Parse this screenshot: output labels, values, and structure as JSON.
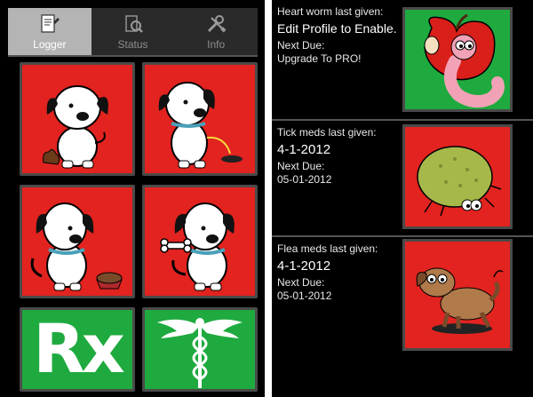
{
  "tabs": [
    {
      "label": "Logger",
      "icon": "document-pen-icon",
      "active": true
    },
    {
      "label": "Status",
      "icon": "magnifier-document-icon",
      "active": false
    },
    {
      "label": "Info",
      "icon": "wrench-screwdriver-icon",
      "active": false
    }
  ],
  "tiles": [
    {
      "name": "dog-poop-tile",
      "color": "#e2231f"
    },
    {
      "name": "dog-pee-tile",
      "color": "#e2231f"
    },
    {
      "name": "dog-food-tile",
      "color": "#e2231f"
    },
    {
      "name": "dog-treat-tile",
      "color": "#e2231f"
    },
    {
      "name": "rx-tile",
      "color": "#1faa3f",
      "text": "Rx"
    },
    {
      "name": "caduceus-tile",
      "color": "#1faa3f"
    }
  ],
  "reminders": [
    {
      "label": "Heart worm last given:",
      "value": "Edit Profile to Enable.",
      "due_label": "Next Due:",
      "due_value": "Upgrade To PRO!",
      "tile_color": "#1faa3f",
      "icon": "worm-apple-icon"
    },
    {
      "label": "Tick meds last given:",
      "value": "4-1-2012",
      "due_label": "Next Due:",
      "due_value": "05-01-2012",
      "tile_color": "#e2231f",
      "icon": "tick-bug-icon"
    },
    {
      "label": "Flea meds last given:",
      "value": "4-1-2012",
      "due_label": "Next Due:",
      "due_value": "05-01-2012",
      "tile_color": "#e2231f",
      "icon": "scratching-dog-icon"
    }
  ]
}
